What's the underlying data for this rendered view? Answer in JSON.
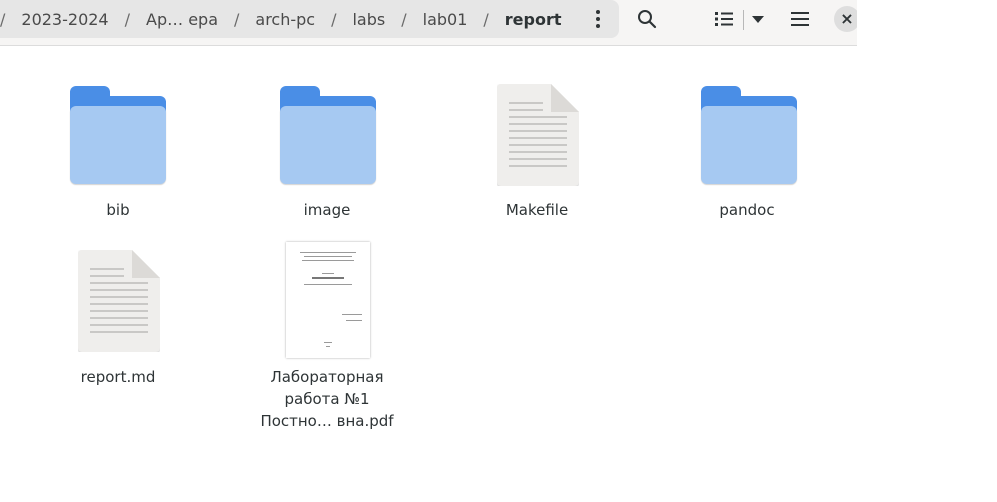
{
  "header": {
    "breadcrumbs": [
      "2023-2024",
      "Ар… ера",
      "arch-pc",
      "labs",
      "lab01",
      "report"
    ],
    "separator": "/",
    "icons": {
      "menu": "kebab-menu-icon",
      "search": "search-icon",
      "view": "list-view-icon",
      "view_dropdown": "chevron-down-icon",
      "main_menu": "hamburger-menu-icon",
      "close": "close-icon"
    },
    "close_glyph": "×"
  },
  "files": [
    {
      "name": "bib",
      "type": "folder"
    },
    {
      "name": "image",
      "type": "folder"
    },
    {
      "name": "Makefile",
      "type": "text"
    },
    {
      "name": "pandoc",
      "type": "folder"
    },
    {
      "name": "report.md",
      "type": "text"
    },
    {
      "name": "Лабораторная работа №1 Постно… вна.pdf",
      "type": "pdf",
      "label_lines": [
        "Лабораторная",
        "работа №1",
        "Постно… вна.pdf"
      ]
    }
  ],
  "colors": {
    "folder_dark": "#4a8ee6",
    "folder_light": "#a6c9f2",
    "pathbar_bg": "#e6e6e6",
    "headerbar_bg": "#f6f5f4"
  }
}
